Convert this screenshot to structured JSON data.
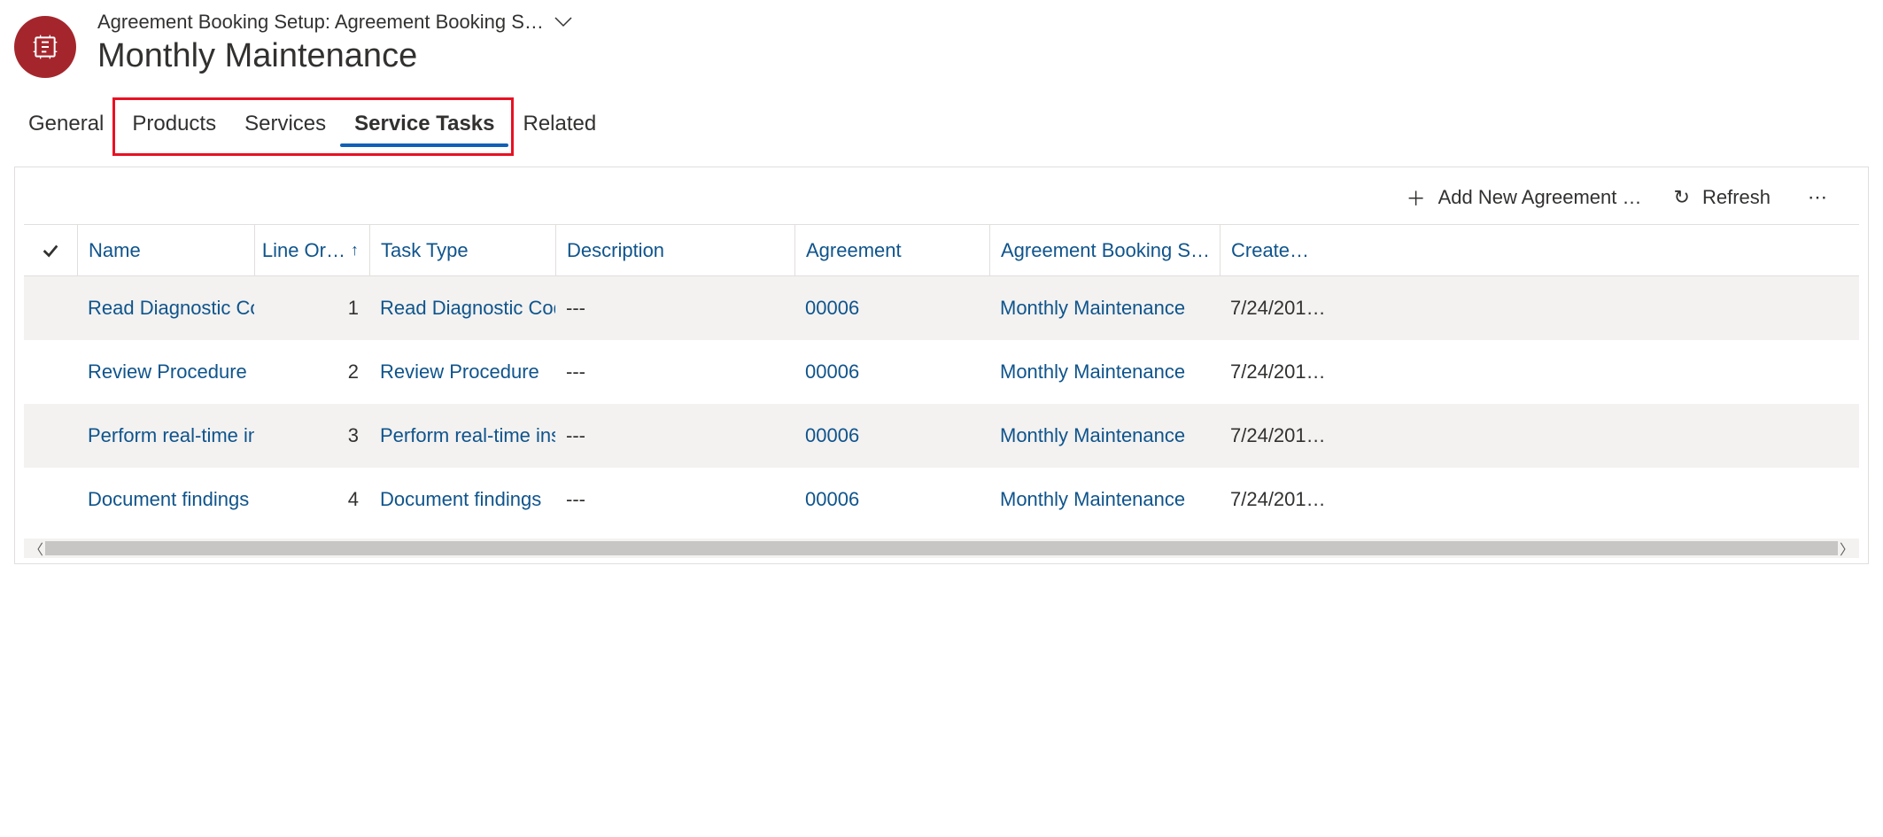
{
  "header": {
    "breadcrumb": "Agreement Booking Setup: Agreement Booking S…",
    "title": "Monthly Maintenance"
  },
  "tabs": [
    {
      "label": "General",
      "active": false
    },
    {
      "label": "Products",
      "active": false
    },
    {
      "label": "Services",
      "active": false
    },
    {
      "label": "Service Tasks",
      "active": true
    },
    {
      "label": "Related",
      "active": false
    }
  ],
  "commands": {
    "add_label": "Add New Agreement …",
    "refresh_label": "Refresh"
  },
  "grid": {
    "columns": {
      "name": "Name",
      "line_order": "Line Or…",
      "task_type": "Task Type",
      "description": "Description",
      "agreement": "Agreement",
      "abs": "Agreement Booking S…",
      "created": "Create…"
    },
    "rows": [
      {
        "name": "Read Diagnostic Codes",
        "line": "1",
        "type": "Read Diagnostic Codes",
        "desc": "---",
        "agr": "00006",
        "abs": "Monthly Maintenance",
        "created": "7/24/201…"
      },
      {
        "name": "Review Procedure",
        "line": "2",
        "type": "Review Procedure",
        "desc": "---",
        "agr": "00006",
        "abs": "Monthly Maintenance",
        "created": "7/24/201…"
      },
      {
        "name": "Perform real-time insp",
        "line": "3",
        "type": "Perform real-time insp",
        "desc": "---",
        "agr": "00006",
        "abs": "Monthly Maintenance",
        "created": "7/24/201…"
      },
      {
        "name": "Document findings",
        "line": "4",
        "type": "Document findings",
        "desc": "---",
        "agr": "00006",
        "abs": "Monthly Maintenance",
        "created": "7/24/201…"
      }
    ]
  }
}
